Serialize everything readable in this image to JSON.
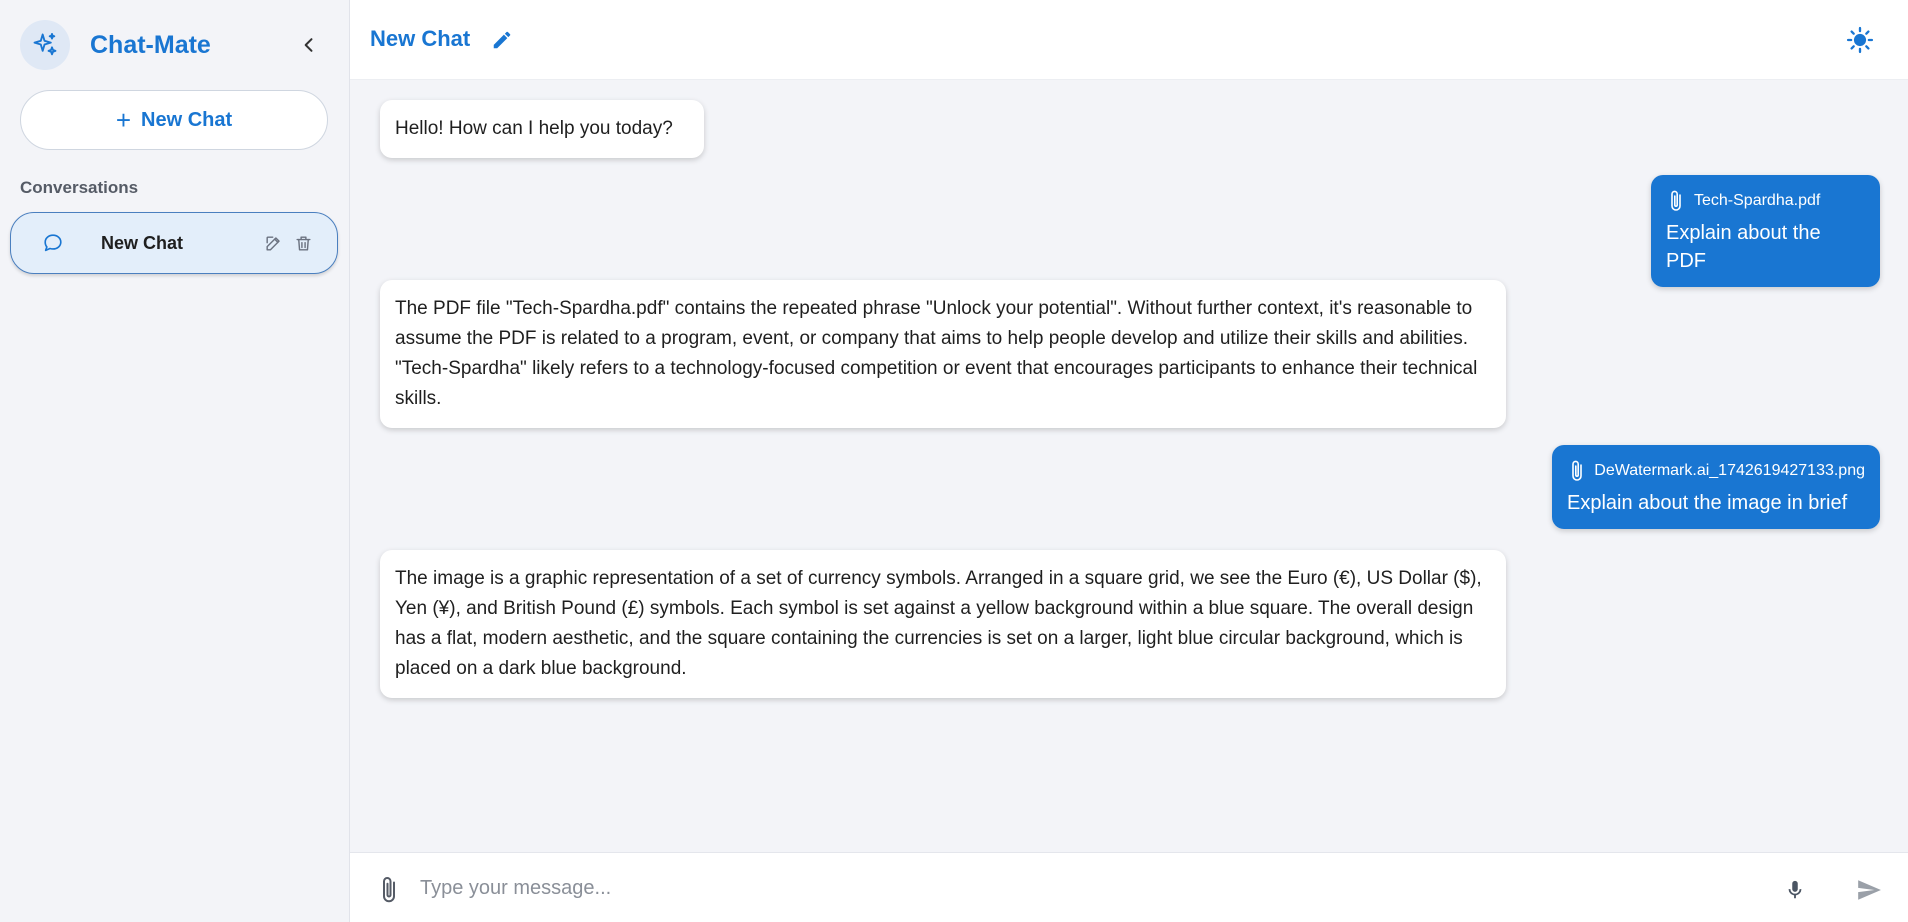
{
  "sidebar": {
    "app_name": "Chat-Mate",
    "new_chat_label": "New Chat",
    "section_label": "Conversations",
    "conversations": [
      {
        "label": "New Chat"
      }
    ]
  },
  "header": {
    "title": "New Chat"
  },
  "messages": [
    {
      "role": "bot",
      "text": "Hello! How can I help you today?"
    },
    {
      "role": "user",
      "attachment": "Tech-Spardha.pdf",
      "text": "Explain about the PDF"
    },
    {
      "role": "bot",
      "text": "The PDF file \"Tech-Spardha.pdf\" contains the repeated phrase \"Unlock your potential\". Without further context, it's reasonable to assume the PDF is related to a program, event, or company that aims to help people develop and utilize their skills and abilities. \"Tech-Spardha\" likely refers to a technology-focused competition or event that encourages participants to enhance their technical skills."
    },
    {
      "role": "user",
      "attachment": "DeWatermark.ai_1742619427133.png",
      "text": "Explain about the image in brief"
    },
    {
      "role": "bot",
      "text": "The image is a graphic representation of a set of currency symbols. Arranged in a square grid, we see the Euro (€), US Dollar ($), Yen (¥), and British Pound (£) symbols. Each symbol is set against a yellow background within a blue square. The overall design has a flat, modern aesthetic, and the square containing the currencies is set on a larger, light blue circular background, which is placed on a dark blue background."
    }
  ],
  "composer": {
    "placeholder": "Type your message..."
  },
  "icons": {
    "logo": "sparkles-icon",
    "collapse": "chevron-left-icon",
    "new_chat": "plus-icon",
    "conversation": "chat-bubble-icon",
    "edit": "pencil-icon",
    "delete": "trash-icon",
    "theme": "sun-icon",
    "attach": "paperclip-icon",
    "mic": "microphone-icon",
    "send": "send-icon"
  },
  "colors": {
    "accent": "#1976d2",
    "background": "#f3f4f8",
    "surface": "#ffffff",
    "selected_conversation": "#e3eefa"
  }
}
